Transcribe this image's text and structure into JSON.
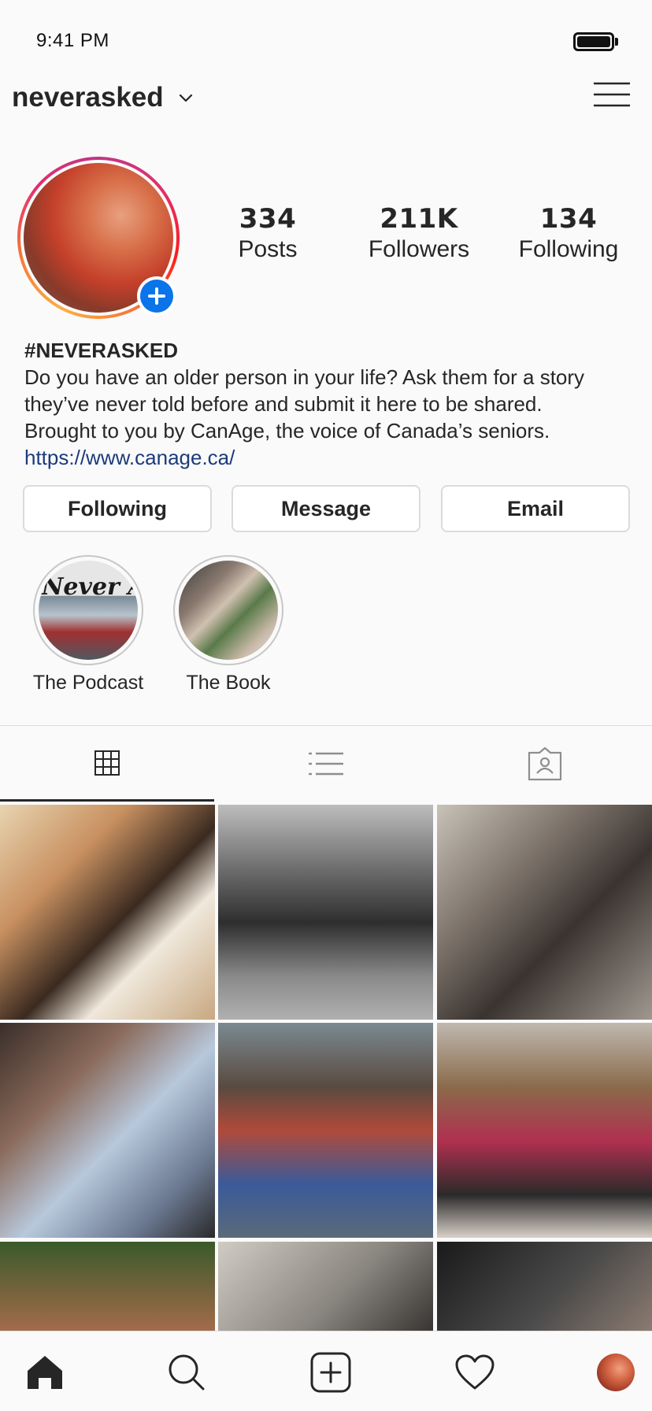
{
  "status_bar": {
    "time": "9:41 PM"
  },
  "header": {
    "username": "neverasked"
  },
  "profile": {
    "stats": [
      {
        "value": "334",
        "label": "Posts"
      },
      {
        "value": "211K",
        "label": "Followers"
      },
      {
        "value": "134",
        "label": "Following"
      }
    ],
    "bio": {
      "name": "#NEVERASKED",
      "lines": [
        "Do you have an older person in your life? Ask them for a story",
        "they’ve never told before and submit it here to be shared.",
        "Brought to you by CanAge, the voice of Canada’s seniors."
      ],
      "link": "https://www.canage.ca/"
    }
  },
  "actions": {
    "following": "Following",
    "message": "Message",
    "email": "Email"
  },
  "highlights": [
    {
      "label": "The Podcast",
      "cover_text": "Never Asked"
    },
    {
      "label": "The Book"
    }
  ],
  "tabs": [
    "grid-icon",
    "list-icon",
    "tagged-icon"
  ],
  "active_tab": "grid",
  "bottom_nav": [
    "home-icon",
    "search-icon",
    "add-post-icon",
    "heart-icon",
    "profile-avatar"
  ],
  "colors": {
    "accent_blue": "#0a74e8",
    "link": "#1b3b7a",
    "border": "#dbdbdb"
  }
}
